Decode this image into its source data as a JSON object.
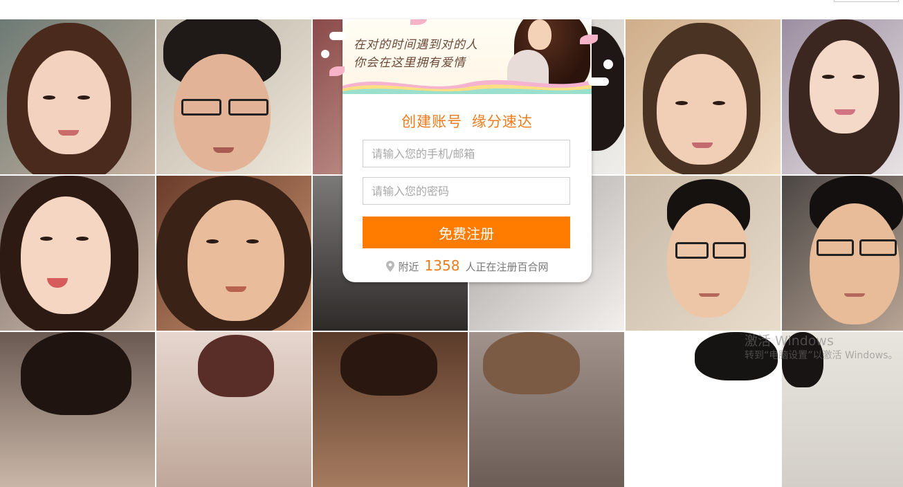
{
  "banner": {
    "line1": "在对的时间遇到对的人",
    "line2": "你会在这里拥有爱情"
  },
  "form": {
    "title": "创建账号 缘分速达",
    "account_placeholder": "请输入您的手机/邮箱",
    "password_placeholder": "请输入您的密码",
    "submit_label": "免费注册"
  },
  "nearby": {
    "prefix": "附近",
    "count": "1358",
    "suffix": "人正在注册百合网",
    "icon": "location-pin-icon"
  },
  "watermark": {
    "line1": "激活 Windows",
    "line2": "转到“电脑设置”以激活 Windows。"
  },
  "colors": {
    "accent": "#ff7c00",
    "title": "#f07b1c"
  }
}
